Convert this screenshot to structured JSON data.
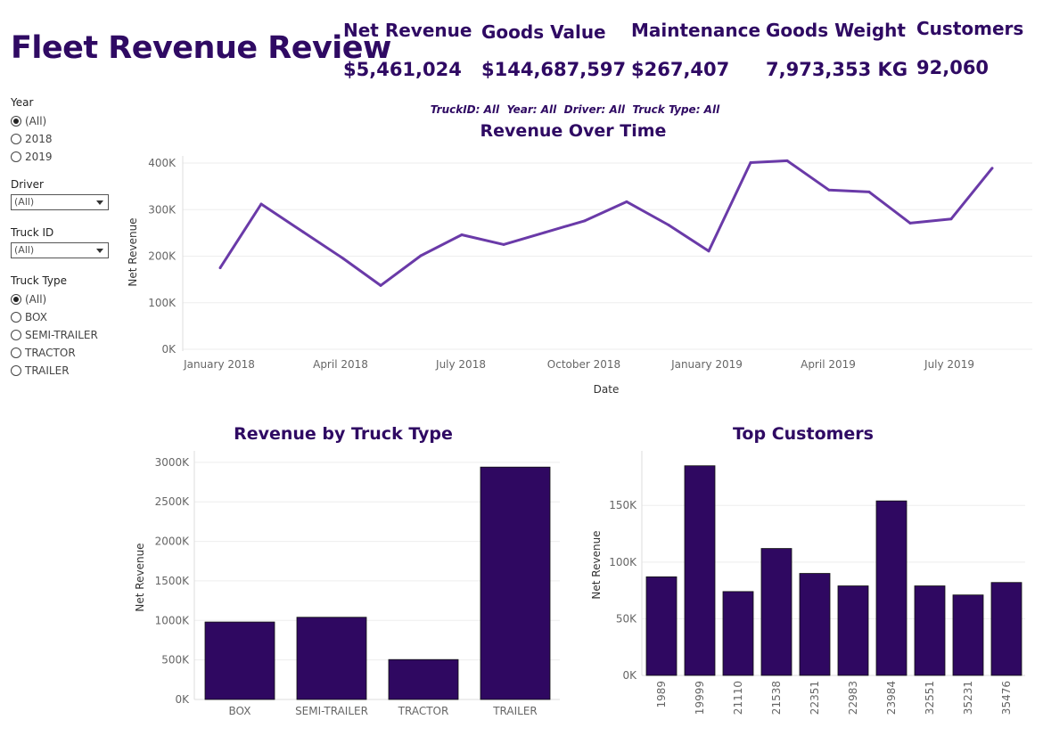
{
  "page": {
    "title": "Fleet Revenue Review"
  },
  "kpis": [
    {
      "label": "Net Revenue",
      "value": "$5,461,024"
    },
    {
      "label": "Goods Value",
      "value": "$144,687,597"
    },
    {
      "label": "Maintenance",
      "value": "$267,407"
    },
    {
      "label": "Goods Weight",
      "value": "7,973,353 KG"
    },
    {
      "label": "Customers",
      "value": "92,060"
    }
  ],
  "filters": {
    "year": {
      "title": "Year",
      "options": [
        "(All)",
        "2018",
        "2019"
      ],
      "selected": "(All)"
    },
    "driver": {
      "title": "Driver",
      "value": "(All)"
    },
    "truck_id": {
      "title": "Truck ID",
      "value": "(All)"
    },
    "truck_type": {
      "title": "Truck Type",
      "options": [
        "(All)",
        "BOX",
        "SEMI-TRAILER",
        "TRACTOR",
        "TRAILER"
      ],
      "selected": "(All)"
    }
  },
  "filter_summary": "TruckID: All  Year: All  Driver: All  Truck Type: All",
  "colors": {
    "accent": "#2f0a63",
    "line": "#6a3aa8",
    "bar": "#2f0861"
  },
  "chart_data": [
    {
      "type": "line",
      "title": "Revenue Over Time",
      "xlabel": "Date",
      "ylabel": "Net Revenue",
      "x_tick_labels": [
        "January 2018",
        "April 2018",
        "July 2018",
        "October 2018",
        "January 2019",
        "April 2019",
        "July 2019"
      ],
      "y_tick_labels": [
        "0K",
        "100K",
        "200K",
        "300K",
        "400K"
      ],
      "ylim": [
        0,
        400000
      ],
      "x": [
        "2018-01",
        "2018-02",
        "2018-03",
        "2018-04",
        "2018-05",
        "2018-06",
        "2018-07",
        "2018-08",
        "2018-09",
        "2018-10",
        "2018-11",
        "2018-12",
        "2019-01",
        "2019-02",
        "2019-03",
        "2019-04",
        "2019-05",
        "2019-06",
        "2019-07",
        "2019-08"
      ],
      "values": [
        175000,
        312000,
        252000,
        195000,
        137000,
        201000,
        246000,
        225000,
        251000,
        276000,
        317000,
        267000,
        211000,
        401000,
        405000,
        342000,
        338000,
        271000,
        280000,
        389000
      ],
      "grid": true
    },
    {
      "type": "bar",
      "title": "Revenue by Truck Type",
      "xlabel": "",
      "ylabel": "Net Revenue",
      "categories": [
        "BOX",
        "SEMI-TRAILER",
        "TRACTOR",
        "TRAILER"
      ],
      "values": [
        980000,
        1040000,
        505000,
        2940000
      ],
      "y_tick_labels": [
        "0K",
        "500K",
        "1000K",
        "1500K",
        "2000K",
        "2500K",
        "3000K"
      ],
      "ylim": [
        0,
        3100000
      ],
      "grid": true
    },
    {
      "type": "bar",
      "title": "Top Customers",
      "xlabel": "",
      "ylabel": "Net Revenue",
      "categories": [
        "1989",
        "19999",
        "21110",
        "21538",
        "22351",
        "22983",
        "23984",
        "32551",
        "35231",
        "35476"
      ],
      "values": [
        87000,
        185000,
        74000,
        112000,
        90000,
        79000,
        154000,
        79000,
        71000,
        82000
      ],
      "y_tick_labels": [
        "0K",
        "50K",
        "100K",
        "150K"
      ],
      "ylim": [
        0,
        195000
      ],
      "grid": true
    }
  ]
}
